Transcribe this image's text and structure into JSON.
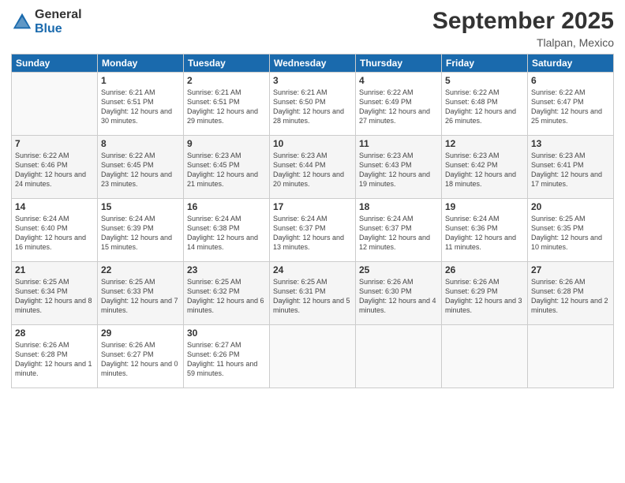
{
  "header": {
    "logo_general": "General",
    "logo_blue": "Blue",
    "month": "September 2025",
    "location": "Tlalpan, Mexico"
  },
  "weekdays": [
    "Sunday",
    "Monday",
    "Tuesday",
    "Wednesday",
    "Thursday",
    "Friday",
    "Saturday"
  ],
  "weeks": [
    [
      {
        "day": "",
        "sunrise": "",
        "sunset": "",
        "daylight": ""
      },
      {
        "day": "1",
        "sunrise": "Sunrise: 6:21 AM",
        "sunset": "Sunset: 6:51 PM",
        "daylight": "Daylight: 12 hours and 30 minutes."
      },
      {
        "day": "2",
        "sunrise": "Sunrise: 6:21 AM",
        "sunset": "Sunset: 6:51 PM",
        "daylight": "Daylight: 12 hours and 29 minutes."
      },
      {
        "day": "3",
        "sunrise": "Sunrise: 6:21 AM",
        "sunset": "Sunset: 6:50 PM",
        "daylight": "Daylight: 12 hours and 28 minutes."
      },
      {
        "day": "4",
        "sunrise": "Sunrise: 6:22 AM",
        "sunset": "Sunset: 6:49 PM",
        "daylight": "Daylight: 12 hours and 27 minutes."
      },
      {
        "day": "5",
        "sunrise": "Sunrise: 6:22 AM",
        "sunset": "Sunset: 6:48 PM",
        "daylight": "Daylight: 12 hours and 26 minutes."
      },
      {
        "day": "6",
        "sunrise": "Sunrise: 6:22 AM",
        "sunset": "Sunset: 6:47 PM",
        "daylight": "Daylight: 12 hours and 25 minutes."
      }
    ],
    [
      {
        "day": "7",
        "sunrise": "Sunrise: 6:22 AM",
        "sunset": "Sunset: 6:46 PM",
        "daylight": "Daylight: 12 hours and 24 minutes."
      },
      {
        "day": "8",
        "sunrise": "Sunrise: 6:22 AM",
        "sunset": "Sunset: 6:45 PM",
        "daylight": "Daylight: 12 hours and 23 minutes."
      },
      {
        "day": "9",
        "sunrise": "Sunrise: 6:23 AM",
        "sunset": "Sunset: 6:45 PM",
        "daylight": "Daylight: 12 hours and 21 minutes."
      },
      {
        "day": "10",
        "sunrise": "Sunrise: 6:23 AM",
        "sunset": "Sunset: 6:44 PM",
        "daylight": "Daylight: 12 hours and 20 minutes."
      },
      {
        "day": "11",
        "sunrise": "Sunrise: 6:23 AM",
        "sunset": "Sunset: 6:43 PM",
        "daylight": "Daylight: 12 hours and 19 minutes."
      },
      {
        "day": "12",
        "sunrise": "Sunrise: 6:23 AM",
        "sunset": "Sunset: 6:42 PM",
        "daylight": "Daylight: 12 hours and 18 minutes."
      },
      {
        "day": "13",
        "sunrise": "Sunrise: 6:23 AM",
        "sunset": "Sunset: 6:41 PM",
        "daylight": "Daylight: 12 hours and 17 minutes."
      }
    ],
    [
      {
        "day": "14",
        "sunrise": "Sunrise: 6:24 AM",
        "sunset": "Sunset: 6:40 PM",
        "daylight": "Daylight: 12 hours and 16 minutes."
      },
      {
        "day": "15",
        "sunrise": "Sunrise: 6:24 AM",
        "sunset": "Sunset: 6:39 PM",
        "daylight": "Daylight: 12 hours and 15 minutes."
      },
      {
        "day": "16",
        "sunrise": "Sunrise: 6:24 AM",
        "sunset": "Sunset: 6:38 PM",
        "daylight": "Daylight: 12 hours and 14 minutes."
      },
      {
        "day": "17",
        "sunrise": "Sunrise: 6:24 AM",
        "sunset": "Sunset: 6:37 PM",
        "daylight": "Daylight: 12 hours and 13 minutes."
      },
      {
        "day": "18",
        "sunrise": "Sunrise: 6:24 AM",
        "sunset": "Sunset: 6:37 PM",
        "daylight": "Daylight: 12 hours and 12 minutes."
      },
      {
        "day": "19",
        "sunrise": "Sunrise: 6:24 AM",
        "sunset": "Sunset: 6:36 PM",
        "daylight": "Daylight: 12 hours and 11 minutes."
      },
      {
        "day": "20",
        "sunrise": "Sunrise: 6:25 AM",
        "sunset": "Sunset: 6:35 PM",
        "daylight": "Daylight: 12 hours and 10 minutes."
      }
    ],
    [
      {
        "day": "21",
        "sunrise": "Sunrise: 6:25 AM",
        "sunset": "Sunset: 6:34 PM",
        "daylight": "Daylight: 12 hours and 8 minutes."
      },
      {
        "day": "22",
        "sunrise": "Sunrise: 6:25 AM",
        "sunset": "Sunset: 6:33 PM",
        "daylight": "Daylight: 12 hours and 7 minutes."
      },
      {
        "day": "23",
        "sunrise": "Sunrise: 6:25 AM",
        "sunset": "Sunset: 6:32 PM",
        "daylight": "Daylight: 12 hours and 6 minutes."
      },
      {
        "day": "24",
        "sunrise": "Sunrise: 6:25 AM",
        "sunset": "Sunset: 6:31 PM",
        "daylight": "Daylight: 12 hours and 5 minutes."
      },
      {
        "day": "25",
        "sunrise": "Sunrise: 6:26 AM",
        "sunset": "Sunset: 6:30 PM",
        "daylight": "Daylight: 12 hours and 4 minutes."
      },
      {
        "day": "26",
        "sunrise": "Sunrise: 6:26 AM",
        "sunset": "Sunset: 6:29 PM",
        "daylight": "Daylight: 12 hours and 3 minutes."
      },
      {
        "day": "27",
        "sunrise": "Sunrise: 6:26 AM",
        "sunset": "Sunset: 6:28 PM",
        "daylight": "Daylight: 12 hours and 2 minutes."
      }
    ],
    [
      {
        "day": "28",
        "sunrise": "Sunrise: 6:26 AM",
        "sunset": "Sunset: 6:28 PM",
        "daylight": "Daylight: 12 hours and 1 minute."
      },
      {
        "day": "29",
        "sunrise": "Sunrise: 6:26 AM",
        "sunset": "Sunset: 6:27 PM",
        "daylight": "Daylight: 12 hours and 0 minutes."
      },
      {
        "day": "30",
        "sunrise": "Sunrise: 6:27 AM",
        "sunset": "Sunset: 6:26 PM",
        "daylight": "Daylight: 11 hours and 59 minutes."
      },
      {
        "day": "",
        "sunrise": "",
        "sunset": "",
        "daylight": ""
      },
      {
        "day": "",
        "sunrise": "",
        "sunset": "",
        "daylight": ""
      },
      {
        "day": "",
        "sunrise": "",
        "sunset": "",
        "daylight": ""
      },
      {
        "day": "",
        "sunrise": "",
        "sunset": "",
        "daylight": ""
      }
    ]
  ]
}
